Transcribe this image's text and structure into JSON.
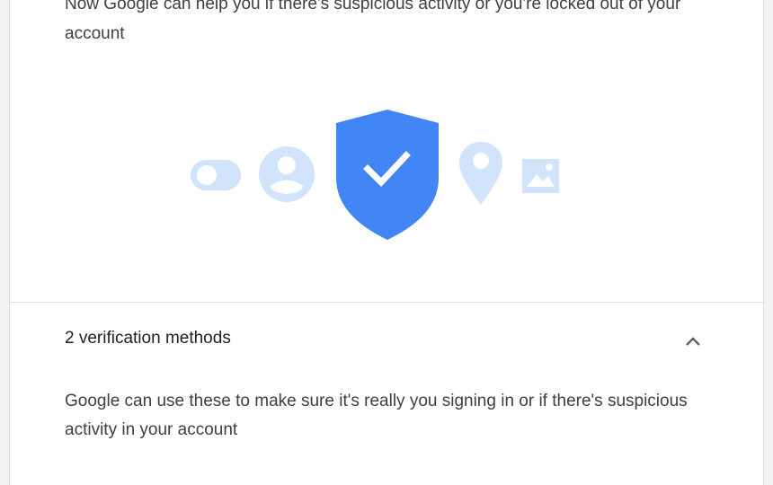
{
  "intro": {
    "text": "Now Google can help you if there's suspicious activity or you're locked out of your account"
  },
  "illustration": {
    "icons": [
      "toggle-icon",
      "account-icon",
      "shield-check-icon",
      "location-pin-icon",
      "photo-icon"
    ],
    "accent_color": "#4285f4",
    "faded_color": "#d2e3fc"
  },
  "verification": {
    "title": "2 verification methods",
    "expanded": true,
    "description": "Google can use these to make sure it's really you signing in or if there's suspicious activity in your account"
  }
}
